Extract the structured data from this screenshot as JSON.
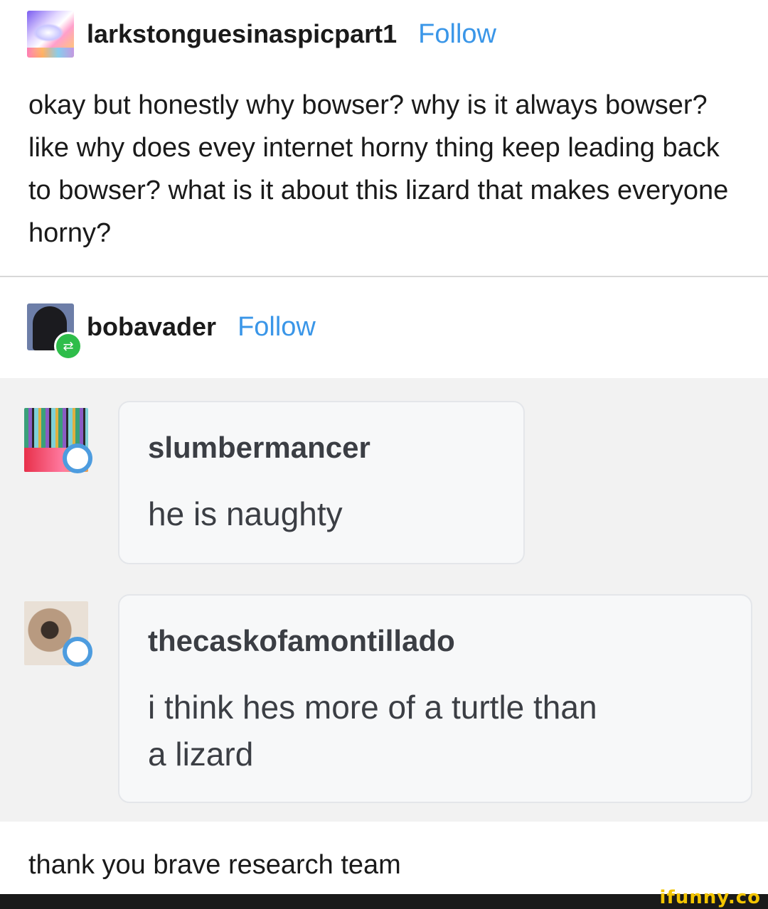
{
  "post": {
    "username": "larkstonguesinaspicpart1",
    "follow_label": "Follow",
    "text": "okay but honestly why bowser? why is it always bowser? like why does evey internet horny thing keep leading back to bowser? what is it about this lizard that makes everyone horny?"
  },
  "reblog": {
    "username": "bobavader",
    "follow_label": "Follow"
  },
  "comments": [
    {
      "username": "slumbermancer",
      "text": "he is naughty"
    },
    {
      "username": "thecaskofamontillado",
      "text": "i think hes more of a turtle than a lizard"
    }
  ],
  "caption": "thank you brave research team",
  "watermark": "ifunny.co"
}
